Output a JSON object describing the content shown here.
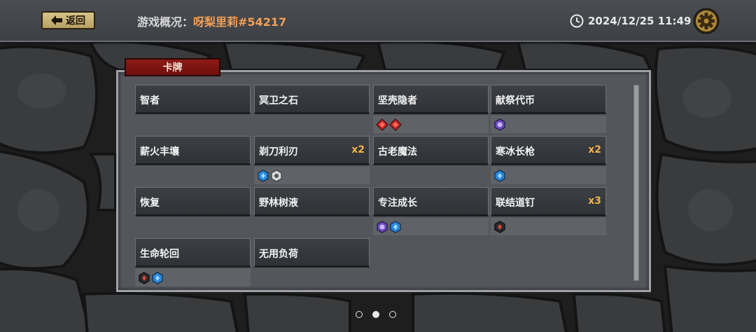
{
  "header": {
    "back_label": "返回",
    "title_prefix": "游戏概况：",
    "player_name": "呀梨里莉#54217",
    "datetime": "2024/12/25 11:49"
  },
  "section_tab": "卡牌",
  "cards": [
    {
      "name": "智者",
      "mult": "",
      "gems": []
    },
    {
      "name": "冥卫之石",
      "mult": "",
      "gems": []
    },
    {
      "name": "坚壳隐者",
      "mult": "",
      "gems": [
        "red-diamond-gem-icon",
        "red-diamond-gem-icon"
      ]
    },
    {
      "name": "献祭代币",
      "mult": "",
      "gems": [
        "purple-hex-gem-icon"
      ]
    },
    {
      "name": "薪火丰壤",
      "mult": "",
      "gems": []
    },
    {
      "name": "剃刀利刃",
      "mult": "x2",
      "gems": [
        "blue-hex-gem-icon",
        "white-hex-gem-icon"
      ]
    },
    {
      "name": "古老魔法",
      "mult": "",
      "gems": []
    },
    {
      "name": "寒冰长枪",
      "mult": "x2",
      "gems": [
        "blue-hex-gem-icon"
      ]
    },
    {
      "name": "恢复",
      "mult": "",
      "gems": []
    },
    {
      "name": "野林树液",
      "mult": "",
      "gems": []
    },
    {
      "name": "专注成长",
      "mult": "",
      "gems": [
        "purple-hex-gem-icon",
        "blue-hex-gem-icon"
      ]
    },
    {
      "name": "联结道钉",
      "mult": "x3",
      "gems": [
        "black-hex-gem-icon"
      ]
    },
    {
      "name": "生命轮回",
      "mult": "",
      "gems": [
        "black-hex-gem-icon",
        "blue-hex-gem-icon"
      ]
    },
    {
      "name": "无用负荷",
      "mult": "",
      "gems": []
    }
  ],
  "pagination": {
    "pages": 3,
    "current": 2
  },
  "colors": {
    "accent_orange": "#f0a05a",
    "multiplier": "#f3b24a",
    "tab_red": "#8e1a16",
    "panel": "#53565b"
  }
}
